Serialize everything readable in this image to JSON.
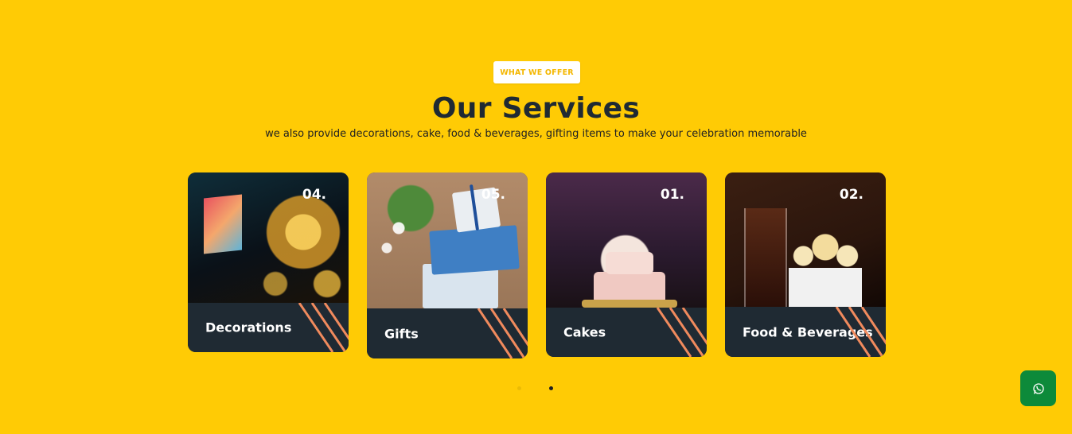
{
  "header": {
    "badge": "WHAT WE OFFER",
    "title": "Our Services",
    "subtitle": "we also provide decorations, cake, food & beverages, gifting items to make your celebration memorable"
  },
  "services": [
    {
      "number": "04.",
      "label": "Decorations"
    },
    {
      "number": "05.",
      "label": "Gifts"
    },
    {
      "number": "01.",
      "label": "Cakes"
    },
    {
      "number": "02.",
      "label": "Food & Beverages"
    }
  ],
  "carousel": {
    "active_dot": 2,
    "dot_count": 2
  },
  "colors": {
    "background": "#ffcb05",
    "card_footer": "#1f2a33",
    "stripe": "#f08a5d",
    "whatsapp": "#0d8a3a"
  },
  "icons": {
    "whatsapp": "whatsapp-icon"
  }
}
